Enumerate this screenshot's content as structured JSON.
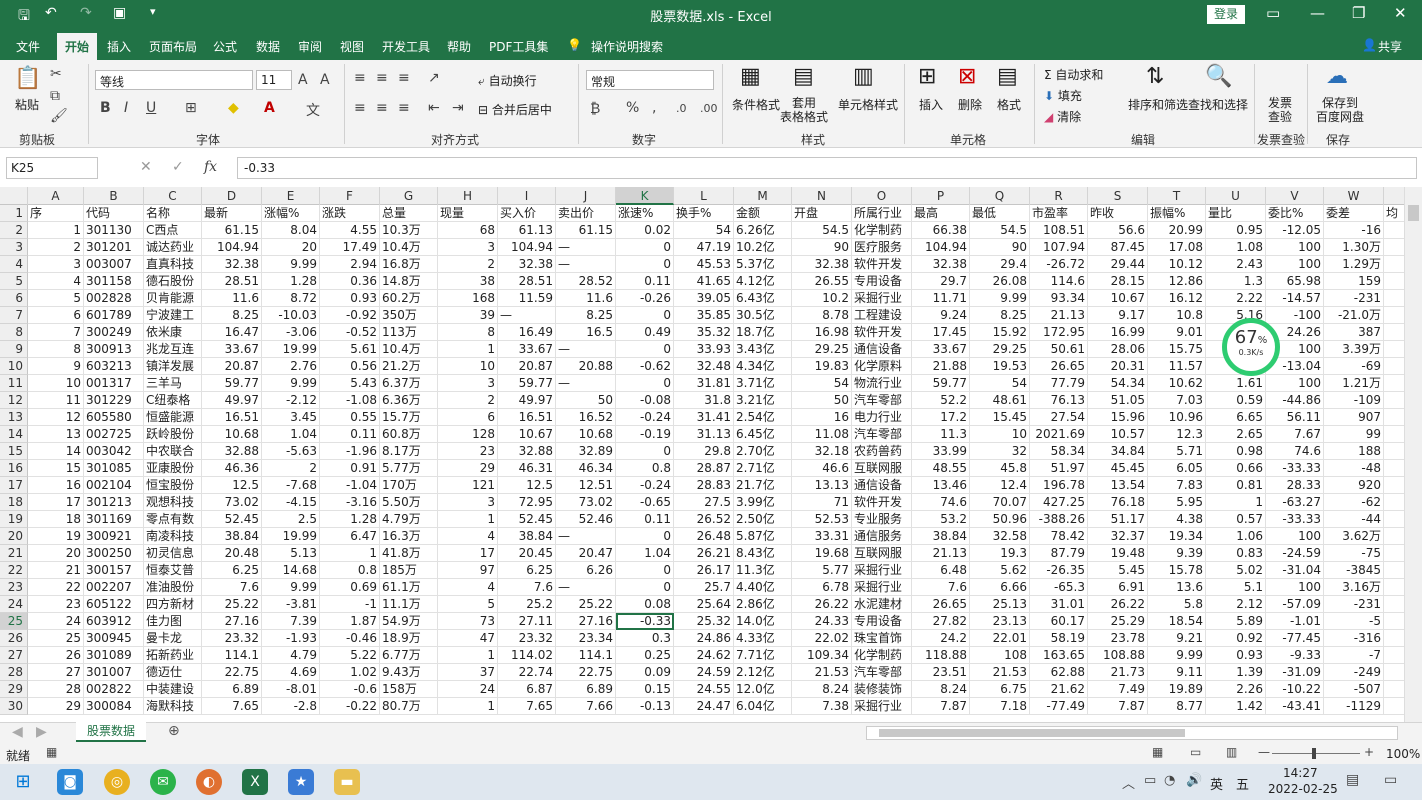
{
  "window": {
    "title": "股票数据.xls - Excel",
    "login": "登录"
  },
  "menu": [
    "文件",
    "开始",
    "插入",
    "页面布局",
    "公式",
    "数据",
    "审阅",
    "视图",
    "开发工具",
    "帮助",
    "PDF工具集"
  ],
  "menu_search": "操作说明搜索",
  "share": "共享",
  "ribbon": {
    "paste": "粘贴",
    "font_name": "等线",
    "font_size": "11",
    "wrap": "自动换行",
    "merge": "合并后居中",
    "number_format": "常规",
    "cond_format": "条件格式",
    "table_format": "套用\n表格格式",
    "cell_style": "单元格样式",
    "insert": "插入",
    "delete": "删除",
    "format": "格式",
    "autosum": "自动求和",
    "fill": "填充",
    "clear": "清除",
    "sort": "排序和筛选",
    "find": "查找和选择",
    "invoice": "发票\n查验",
    "save_baidu": "保存到\n百度网盘",
    "groups": [
      "剪贴板",
      "字体",
      "对齐方式",
      "数字",
      "样式",
      "单元格",
      "编辑",
      "发票查验",
      "保存"
    ]
  },
  "formula_bar": {
    "cell": "K25",
    "fx": "fx",
    "value": "-0.33"
  },
  "columns": [
    "A",
    "B",
    "C",
    "D",
    "E",
    "F",
    "G",
    "H",
    "I",
    "J",
    "K",
    "L",
    "M",
    "N",
    "O",
    "P",
    "Q",
    "R",
    "S",
    "T",
    "U",
    "V",
    "W",
    ""
  ],
  "rows": [
    [
      "序",
      "代码",
      "名称",
      "最新",
      "涨幅%",
      "涨跌",
      "总量",
      "现量",
      "买入价",
      "卖出价",
      "涨速%",
      "换手%",
      "金额",
      "开盘",
      "所属行业",
      "最高",
      "最低",
      "市盈率",
      "昨收",
      "振幅%",
      "量比",
      "委比%",
      "委差",
      "均"
    ],
    [
      "1",
      "301130",
      "C西点",
      "61.15",
      "8.04",
      "4.55",
      "10.3万",
      "68",
      "61.13",
      "61.15",
      "0.02",
      "54",
      "6.26亿",
      "54.5",
      "化学制药",
      "66.38",
      "54.5",
      "108.51",
      "56.6",
      "20.99",
      "0.95",
      "-12.05",
      "-16",
      ""
    ],
    [
      "2",
      "301201",
      "诚达药业",
      "104.94",
      "20",
      "17.49",
      "10.4万",
      "3",
      "104.94",
      "—",
      "0",
      "47.19",
      "10.2亿",
      "90",
      "医疗服务",
      "104.94",
      "90",
      "107.94",
      "87.45",
      "17.08",
      "1.08",
      "100",
      "1.30万",
      ""
    ],
    [
      "3",
      "003007",
      "直真科技",
      "32.38",
      "9.99",
      "2.94",
      "16.8万",
      "2",
      "32.38",
      "—",
      "0",
      "45.53",
      "5.37亿",
      "32.38",
      "软件开发",
      "32.38",
      "29.4",
      "-26.72",
      "29.44",
      "10.12",
      "2.43",
      "100",
      "1.29万",
      ""
    ],
    [
      "4",
      "301158",
      "德石股份",
      "28.51",
      "1.28",
      "0.36",
      "14.8万",
      "38",
      "28.51",
      "28.52",
      "0.11",
      "41.65",
      "4.12亿",
      "26.55",
      "专用设备",
      "29.7",
      "26.08",
      "114.6",
      "28.15",
      "12.86",
      "1.3",
      "65.98",
      "159",
      ""
    ],
    [
      "5",
      "002828",
      "贝肯能源",
      "11.6",
      "8.72",
      "0.93",
      "60.2万",
      "168",
      "11.59",
      "11.6",
      "-0.26",
      "39.05",
      "6.43亿",
      "10.2",
      "采掘行业",
      "11.71",
      "9.99",
      "93.34",
      "10.67",
      "16.12",
      "2.22",
      "-14.57",
      "-231",
      ""
    ],
    [
      "6",
      "601789",
      "宁波建工",
      "8.25",
      "-10.03",
      "-0.92",
      "350万",
      "39",
      "—",
      "8.25",
      "0",
      "35.85",
      "30.5亿",
      "8.78",
      "工程建设",
      "9.24",
      "8.25",
      "21.13",
      "9.17",
      "10.8",
      "5.16",
      "-100",
      "-21.0万",
      ""
    ],
    [
      "7",
      "300249",
      "依米康",
      "16.47",
      "-3.06",
      "-0.52",
      "113万",
      "8",
      "16.49",
      "16.5",
      "0.49",
      "35.32",
      "18.7亿",
      "16.98",
      "软件开发",
      "17.45",
      "15.92",
      "172.95",
      "16.99",
      "9.01",
      "",
      "24.26",
      "387",
      ""
    ],
    [
      "8",
      "300913",
      "兆龙互连",
      "33.67",
      "19.99",
      "5.61",
      "10.4万",
      "1",
      "33.67",
      "—",
      "0",
      "33.93",
      "3.43亿",
      "29.25",
      "通信设备",
      "33.67",
      "29.25",
      "50.61",
      "28.06",
      "15.75",
      "",
      "100",
      "3.39万",
      ""
    ],
    [
      "9",
      "603213",
      "镇洋发展",
      "20.87",
      "2.76",
      "0.56",
      "21.2万",
      "10",
      "20.87",
      "20.88",
      "-0.62",
      "32.48",
      "4.34亿",
      "19.83",
      "化学原料",
      "21.88",
      "19.53",
      "26.65",
      "20.31",
      "11.57",
      "",
      "-13.04",
      "-69",
      ""
    ],
    [
      "10",
      "001317",
      "三羊马",
      "59.77",
      "9.99",
      "5.43",
      "6.37万",
      "3",
      "59.77",
      "—",
      "0",
      "31.81",
      "3.71亿",
      "54",
      "物流行业",
      "59.77",
      "54",
      "77.79",
      "54.34",
      "10.62",
      "1.61",
      "100",
      "1.21万",
      ""
    ],
    [
      "11",
      "301229",
      "C纽泰格",
      "49.97",
      "-2.12",
      "-1.08",
      "6.36万",
      "2",
      "49.97",
      "50",
      "-0.08",
      "31.8",
      "3.21亿",
      "50",
      "汽车零部",
      "52.2",
      "48.61",
      "76.13",
      "51.05",
      "7.03",
      "0.59",
      "-44.86",
      "-109",
      ""
    ],
    [
      "12",
      "605580",
      "恒盛能源",
      "16.51",
      "3.45",
      "0.55",
      "15.7万",
      "6",
      "16.51",
      "16.52",
      "-0.24",
      "31.41",
      "2.54亿",
      "16",
      "电力行业",
      "17.2",
      "15.45",
      "27.54",
      "15.96",
      "10.96",
      "6.65",
      "56.11",
      "907",
      ""
    ],
    [
      "13",
      "002725",
      "跃岭股份",
      "10.68",
      "1.04",
      "0.11",
      "60.8万",
      "128",
      "10.67",
      "10.68",
      "-0.19",
      "31.13",
      "6.45亿",
      "11.08",
      "汽车零部",
      "11.3",
      "10",
      "2021.69",
      "10.57",
      "12.3",
      "2.65",
      "7.67",
      "99",
      ""
    ],
    [
      "14",
      "003042",
      "中农联合",
      "32.88",
      "-5.63",
      "-1.96",
      "8.17万",
      "23",
      "32.88",
      "32.89",
      "0",
      "29.8",
      "2.70亿",
      "32.18",
      "农药兽药",
      "33.99",
      "32",
      "58.34",
      "34.84",
      "5.71",
      "0.98",
      "74.6",
      "188",
      ""
    ],
    [
      "15",
      "301085",
      "亚康股份",
      "46.36",
      "2",
      "0.91",
      "5.77万",
      "29",
      "46.31",
      "46.34",
      "0.8",
      "28.87",
      "2.71亿",
      "46.6",
      "互联网服",
      "48.55",
      "45.8",
      "51.97",
      "45.45",
      "6.05",
      "0.66",
      "-33.33",
      "-48",
      ""
    ],
    [
      "16",
      "002104",
      "恒宝股份",
      "12.5",
      "-7.68",
      "-1.04",
      "170万",
      "121",
      "12.5",
      "12.51",
      "-0.24",
      "28.83",
      "21.7亿",
      "13.13",
      "通信设备",
      "13.46",
      "12.4",
      "196.78",
      "13.54",
      "7.83",
      "0.81",
      "28.33",
      "920",
      ""
    ],
    [
      "17",
      "301213",
      "观想科技",
      "73.02",
      "-4.15",
      "-3.16",
      "5.50万",
      "3",
      "72.95",
      "73.02",
      "-0.65",
      "27.5",
      "3.99亿",
      "71",
      "软件开发",
      "74.6",
      "70.07",
      "427.25",
      "76.18",
      "5.95",
      "1",
      "-63.27",
      "-62",
      ""
    ],
    [
      "18",
      "301169",
      "零点有数",
      "52.45",
      "2.5",
      "1.28",
      "4.79万",
      "1",
      "52.45",
      "52.46",
      "0.11",
      "26.52",
      "2.50亿",
      "52.53",
      "专业服务",
      "53.2",
      "50.96",
      "-388.26",
      "51.17",
      "4.38",
      "0.57",
      "-33.33",
      "-44",
      ""
    ],
    [
      "19",
      "300921",
      "南凌科技",
      "38.84",
      "19.99",
      "6.47",
      "16.3万",
      "4",
      "38.84",
      "—",
      "0",
      "26.48",
      "5.87亿",
      "33.31",
      "通信服务",
      "38.84",
      "32.58",
      "78.42",
      "32.37",
      "19.34",
      "1.06",
      "100",
      "3.62万",
      ""
    ],
    [
      "20",
      "300250",
      "初灵信息",
      "20.48",
      "5.13",
      "1",
      "41.8万",
      "17",
      "20.45",
      "20.47",
      "1.04",
      "26.21",
      "8.43亿",
      "19.68",
      "互联网服",
      "21.13",
      "19.3",
      "87.79",
      "19.48",
      "9.39",
      "0.83",
      "-24.59",
      "-75",
      ""
    ],
    [
      "21",
      "300157",
      "恒泰艾普",
      "6.25",
      "14.68",
      "0.8",
      "185万",
      "97",
      "6.25",
      "6.26",
      "0",
      "26.17",
      "11.3亿",
      "5.77",
      "采掘行业",
      "6.48",
      "5.62",
      "-26.35",
      "5.45",
      "15.78",
      "5.02",
      "-31.04",
      "-3845",
      ""
    ],
    [
      "22",
      "002207",
      "准油股份",
      "7.6",
      "9.99",
      "0.69",
      "61.1万",
      "4",
      "7.6",
      "—",
      "0",
      "25.7",
      "4.40亿",
      "6.78",
      "采掘行业",
      "7.6",
      "6.66",
      "-65.3",
      "6.91",
      "13.6",
      "5.1",
      "100",
      "3.16万",
      ""
    ],
    [
      "23",
      "605122",
      "四方新材",
      "25.22",
      "-3.81",
      "-1",
      "11.1万",
      "5",
      "25.2",
      "25.22",
      "0.08",
      "25.64",
      "2.86亿",
      "26.22",
      "水泥建材",
      "26.65",
      "25.13",
      "31.01",
      "26.22",
      "5.8",
      "2.12",
      "-57.09",
      "-231",
      ""
    ],
    [
      "24",
      "603912",
      "佳力图",
      "27.16",
      "7.39",
      "1.87",
      "54.9万",
      "73",
      "27.11",
      "27.16",
      "-0.33",
      "25.32",
      "14.0亿",
      "24.33",
      "专用设备",
      "27.82",
      "23.13",
      "60.17",
      "25.29",
      "18.54",
      "5.89",
      "-1.01",
      "-5",
      ""
    ],
    [
      "25",
      "300945",
      "曼卡龙",
      "23.32",
      "-1.93",
      "-0.46",
      "18.9万",
      "47",
      "23.32",
      "23.34",
      "0.3",
      "24.86",
      "4.33亿",
      "22.02",
      "珠宝首饰",
      "24.2",
      "22.01",
      "58.19",
      "23.78",
      "9.21",
      "0.92",
      "-77.45",
      "-316",
      ""
    ],
    [
      "26",
      "301089",
      "拓新药业",
      "114.1",
      "4.79",
      "5.22",
      "6.77万",
      "1",
      "114.02",
      "114.1",
      "0.25",
      "24.62",
      "7.71亿",
      "109.34",
      "化学制药",
      "118.88",
      "108",
      "163.65",
      "108.88",
      "9.99",
      "0.93",
      "-9.33",
      "-7",
      ""
    ],
    [
      "27",
      "301007",
      "德迈仕",
      "22.75",
      "4.69",
      "1.02",
      "9.43万",
      "37",
      "22.74",
      "22.75",
      "0.09",
      "24.59",
      "2.12亿",
      "21.53",
      "汽车零部",
      "23.51",
      "21.53",
      "62.88",
      "21.73",
      "9.11",
      "1.39",
      "-31.09",
      "-249",
      ""
    ],
    [
      "28",
      "002822",
      "中装建设",
      "6.89",
      "-8.01",
      "-0.6",
      "158万",
      "24",
      "6.87",
      "6.89",
      "0.15",
      "24.55",
      "12.0亿",
      "8.24",
      "装修装饰",
      "8.24",
      "6.75",
      "21.62",
      "7.49",
      "19.89",
      "2.26",
      "-10.22",
      "-507",
      ""
    ],
    [
      "29",
      "300084",
      "海默科技",
      "7.65",
      "-2.8",
      "-0.22",
      "80.7万",
      "1",
      "7.65",
      "7.66",
      "-0.13",
      "24.47",
      "6.04亿",
      "7.38",
      "采掘行业",
      "7.87",
      "7.18",
      "-77.49",
      "7.87",
      "8.77",
      "1.42",
      "-43.41",
      "-1129",
      ""
    ]
  ],
  "row_numbers": [
    "1",
    "2",
    "3",
    "4",
    "5",
    "6",
    "7",
    "8",
    "9",
    "10",
    "11",
    "12",
    "13",
    "14",
    "15",
    "16",
    "17",
    "18",
    "19",
    "20",
    "21",
    "22",
    "23",
    "24",
    "25",
    "26",
    "27",
    "28",
    "29",
    "30"
  ],
  "sheet_tab": "股票数据",
  "status": {
    "ready": "就绪",
    "zoom": "100%"
  },
  "gauge": {
    "percent": "67",
    "unit": "%",
    "speed": "0.3K/s"
  },
  "taskbar": {
    "ime": "英",
    "layout": "五",
    "time": "14:27",
    "date": "2022-02-25"
  },
  "colors": {
    "excel_green": "#217346",
    "gauge_green": "#2ecc71"
  }
}
